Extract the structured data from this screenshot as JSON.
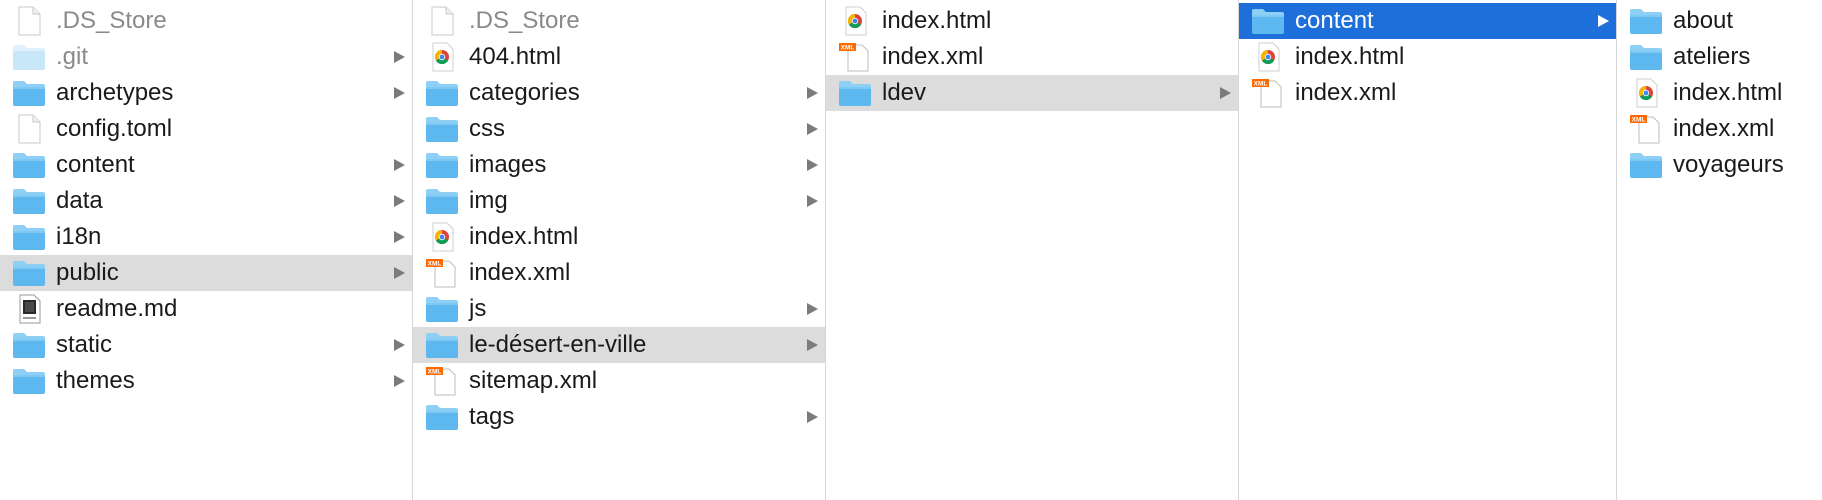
{
  "columns": [
    {
      "items": [
        {
          "label": ".DS_Store",
          "type": "blank",
          "dim": true,
          "has_children": false,
          "state": ""
        },
        {
          "label": ".git",
          "type": "folder-light",
          "dim": true,
          "has_children": true,
          "state": ""
        },
        {
          "label": "archetypes",
          "type": "folder",
          "dim": false,
          "has_children": true,
          "state": ""
        },
        {
          "label": "config.toml",
          "type": "blank",
          "dim": false,
          "has_children": false,
          "state": ""
        },
        {
          "label": "content",
          "type": "folder",
          "dim": false,
          "has_children": true,
          "state": ""
        },
        {
          "label": "data",
          "type": "folder",
          "dim": false,
          "has_children": true,
          "state": ""
        },
        {
          "label": "i18n",
          "type": "folder",
          "dim": false,
          "has_children": true,
          "state": ""
        },
        {
          "label": "public",
          "type": "folder",
          "dim": false,
          "has_children": true,
          "state": "selected"
        },
        {
          "label": "readme.md",
          "type": "markdown",
          "dim": false,
          "has_children": false,
          "state": ""
        },
        {
          "label": "static",
          "type": "folder",
          "dim": false,
          "has_children": true,
          "state": ""
        },
        {
          "label": "themes",
          "type": "folder",
          "dim": false,
          "has_children": true,
          "state": ""
        }
      ]
    },
    {
      "items": [
        {
          "label": ".DS_Store",
          "type": "blank",
          "dim": true,
          "has_children": false,
          "state": ""
        },
        {
          "label": "404.html",
          "type": "chrome-html",
          "dim": false,
          "has_children": false,
          "state": ""
        },
        {
          "label": "categories",
          "type": "folder",
          "dim": false,
          "has_children": true,
          "state": ""
        },
        {
          "label": "css",
          "type": "folder",
          "dim": false,
          "has_children": true,
          "state": ""
        },
        {
          "label": "images",
          "type": "folder",
          "dim": false,
          "has_children": true,
          "state": ""
        },
        {
          "label": "img",
          "type": "folder",
          "dim": false,
          "has_children": true,
          "state": ""
        },
        {
          "label": "index.html",
          "type": "chrome-html",
          "dim": false,
          "has_children": false,
          "state": ""
        },
        {
          "label": "index.xml",
          "type": "xml",
          "dim": false,
          "has_children": false,
          "state": ""
        },
        {
          "label": "js",
          "type": "folder",
          "dim": false,
          "has_children": true,
          "state": ""
        },
        {
          "label": "le-désert-en-ville",
          "type": "folder",
          "dim": false,
          "has_children": true,
          "state": "selected"
        },
        {
          "label": "sitemap.xml",
          "type": "xml",
          "dim": false,
          "has_children": false,
          "state": ""
        },
        {
          "label": "tags",
          "type": "folder",
          "dim": false,
          "has_children": true,
          "state": ""
        }
      ]
    },
    {
      "items": [
        {
          "label": "index.html",
          "type": "chrome-html",
          "dim": false,
          "has_children": false,
          "state": ""
        },
        {
          "label": "index.xml",
          "type": "xml",
          "dim": false,
          "has_children": false,
          "state": ""
        },
        {
          "label": "ldev",
          "type": "folder",
          "dim": false,
          "has_children": true,
          "state": "selected"
        }
      ]
    },
    {
      "items": [
        {
          "label": "content",
          "type": "folder",
          "dim": false,
          "has_children": true,
          "state": "active"
        },
        {
          "label": "index.html",
          "type": "chrome-html",
          "dim": false,
          "has_children": false,
          "state": ""
        },
        {
          "label": "index.xml",
          "type": "xml",
          "dim": false,
          "has_children": false,
          "state": ""
        }
      ]
    },
    {
      "items": [
        {
          "label": "about",
          "type": "folder",
          "dim": false,
          "has_children": false,
          "state": ""
        },
        {
          "label": "ateliers",
          "type": "folder",
          "dim": false,
          "has_children": false,
          "state": ""
        },
        {
          "label": "index.html",
          "type": "chrome-html",
          "dim": false,
          "has_children": false,
          "state": ""
        },
        {
          "label": "index.xml",
          "type": "xml",
          "dim": false,
          "has_children": false,
          "state": ""
        },
        {
          "label": "voyageurs",
          "type": "folder",
          "dim": false,
          "has_children": false,
          "state": ""
        }
      ]
    }
  ],
  "icon_badges": {
    "xml": "XML",
    "code": "</>"
  },
  "colors": {
    "folder_top": "#8ed0f5",
    "folder_front": "#5cb8ee",
    "folder_light": "#c8e8f9",
    "selection_inactive": "#dcdcdc",
    "selection_active": "#1e6fd9",
    "arrow": "#7b7b7b",
    "column_divider": "#d6d6d6"
  }
}
